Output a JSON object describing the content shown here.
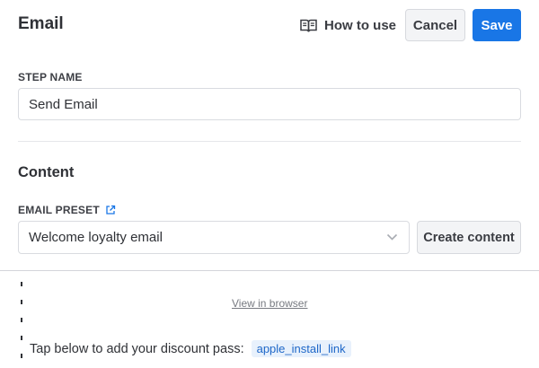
{
  "header": {
    "title": "Email",
    "how_to_use": "How to use",
    "cancel_label": "Cancel",
    "save_label": "Save"
  },
  "step": {
    "label": "STEP NAME",
    "value": "Send Email"
  },
  "content": {
    "title": "Content",
    "preset_label": "EMAIL PRESET",
    "preset_value": "Welcome loyalty email",
    "create_label": "Create content"
  },
  "preview": {
    "view_in_browser": "View in browser",
    "tap_text": "Tap below to add your discount pass:",
    "tag": "apple_install_link"
  },
  "icons": {
    "how_to_use": "book-open-icon",
    "preset_link": "external-link-icon",
    "select_arrow": "chevron-down-icon"
  },
  "colors": {
    "primary": "#1976e6",
    "tag_bg": "#e8f1fc",
    "tag_text": "#1e67c8"
  }
}
